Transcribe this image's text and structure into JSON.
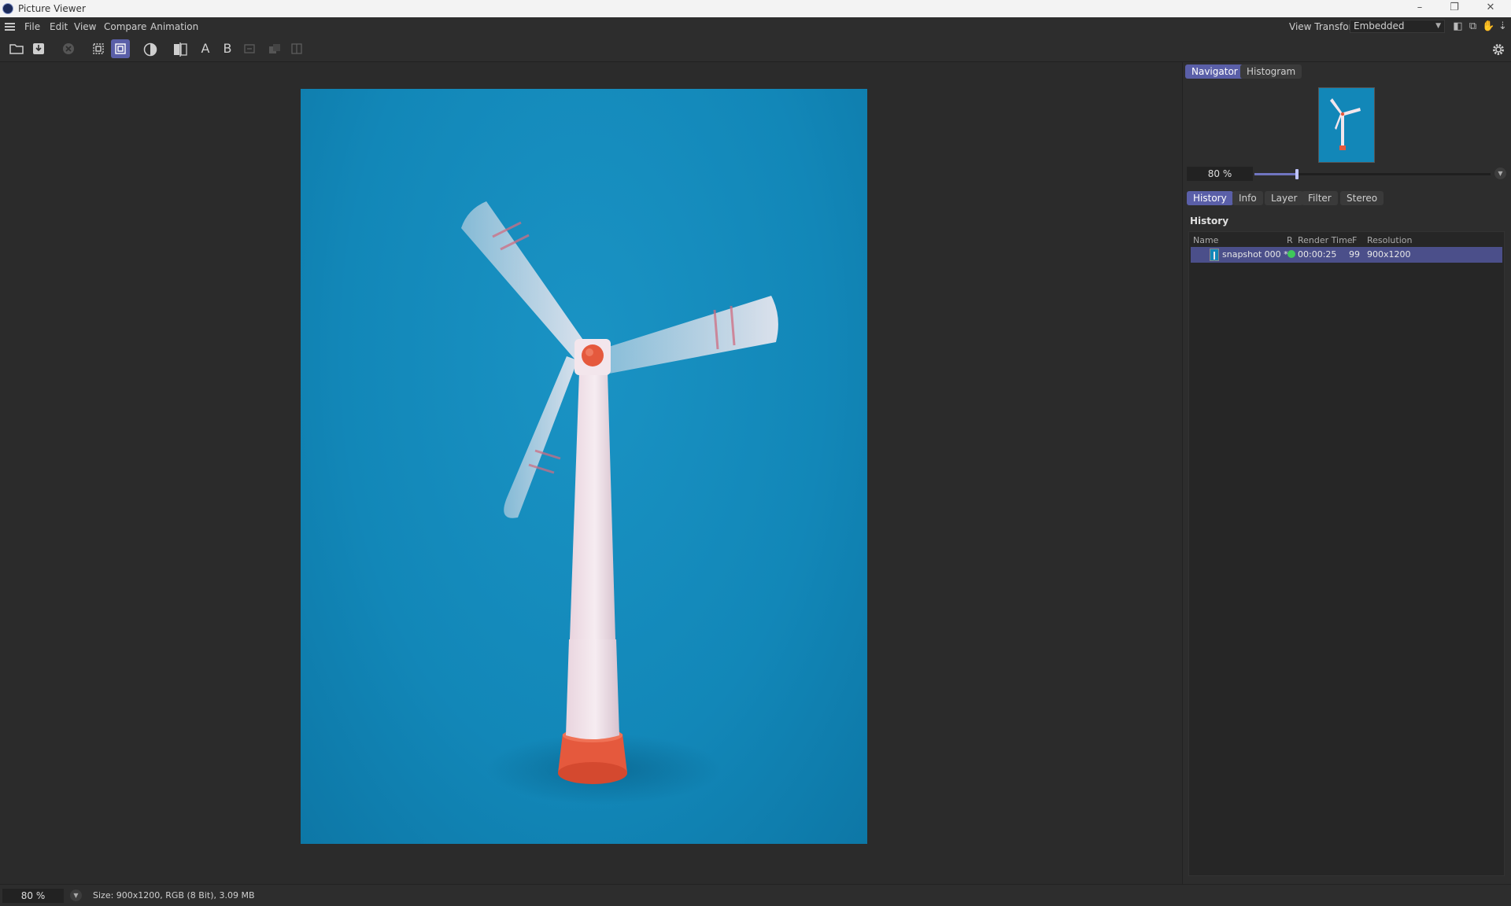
{
  "window": {
    "title": "Picture Viewer",
    "controls": {
      "minimize": "–",
      "restore": "❐",
      "close": "✕"
    }
  },
  "menubar": {
    "items": [
      "File",
      "Edit",
      "View",
      "Compare",
      "Animation"
    ],
    "view_transform_label": "View Transform",
    "view_transform_value": "Embedded"
  },
  "toolbar": {
    "ab_a": "A",
    "ab_b": "B"
  },
  "navigator": {
    "tabs": [
      "Navigator",
      "Histogram"
    ],
    "active_tab": "Navigator",
    "zoom": "80 %",
    "zoom_slider_fraction": 0.18
  },
  "info_tabs": {
    "tabs": [
      "History",
      "Info",
      "Layer",
      "Filter",
      "Stereo"
    ],
    "active_tab": "History"
  },
  "history": {
    "title": "History",
    "columns": [
      "Name",
      "R",
      "Render Time",
      "F",
      "Resolution"
    ],
    "rows": [
      {
        "name": "snapshot 000 *",
        "render_time": "00:00:25",
        "f": "99",
        "resolution": "900x1200",
        "status_color": "#3ec85a"
      }
    ]
  },
  "statusbar": {
    "zoom": "80 %",
    "info": "Size: 900x1200, RGB (8 Bit), 3.09 MB"
  },
  "colors": {
    "accent": "#5a5fa8",
    "render_background": "#1287b8",
    "turbine_body": "#f1e4ea",
    "turbine_base": "#e5593d"
  }
}
